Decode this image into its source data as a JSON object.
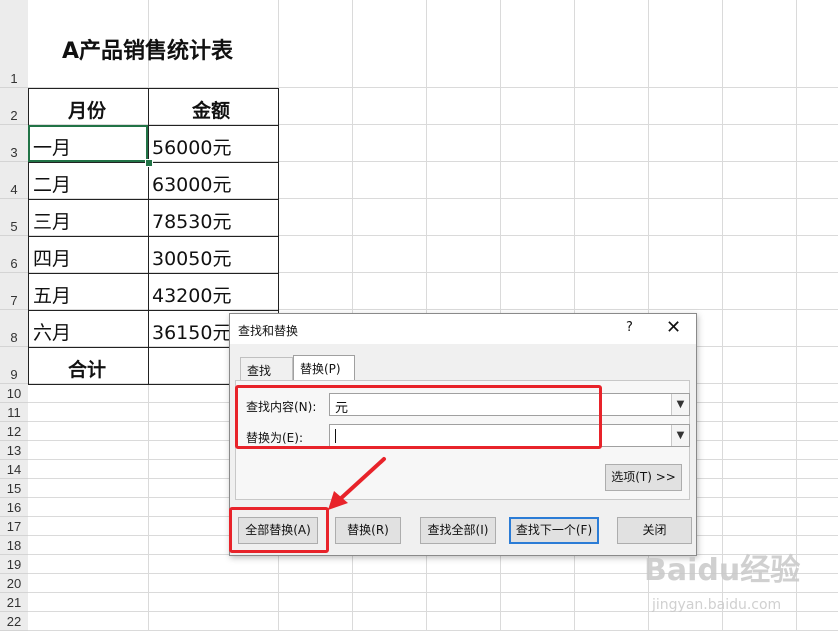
{
  "sheet": {
    "title": "A产品销售统计表",
    "row_numbers": [
      "1",
      "2",
      "3",
      "4",
      "5",
      "6",
      "7",
      "8",
      "9",
      "10",
      "11",
      "12",
      "13",
      "14",
      "15",
      "16",
      "17",
      "18",
      "19",
      "20",
      "21",
      "22"
    ],
    "headers": [
      "月份",
      "金额"
    ],
    "rows": [
      {
        "month": "一月",
        "amount": "56000元"
      },
      {
        "month": "二月",
        "amount": "63000元"
      },
      {
        "month": "三月",
        "amount": "78530元"
      },
      {
        "month": "四月",
        "amount": "30050元"
      },
      {
        "month": "五月",
        "amount": "43200元"
      },
      {
        "month": "六月",
        "amount": "36150元"
      }
    ],
    "total_label": "合计"
  },
  "dialog": {
    "title": "查找和替换",
    "help": "?",
    "close": "✕",
    "tabs": [
      "查找(D)",
      "替换(P)"
    ],
    "find_label": "查找内容(N):",
    "find_value": "元",
    "replace_label": "替换为(E):",
    "replace_value": "",
    "options_button": "选项(T) >>",
    "buttons": [
      "全部替换(A)",
      "替换(R)",
      "查找全部(I)",
      "查找下一个(F)",
      "关闭"
    ]
  },
  "watermark": {
    "brand": "Baidu经验",
    "url": "jingyan.baidu.com"
  },
  "colors": {
    "selection": "#217346",
    "highlight": "#e8232a",
    "default_button": "#2b7cd6"
  }
}
